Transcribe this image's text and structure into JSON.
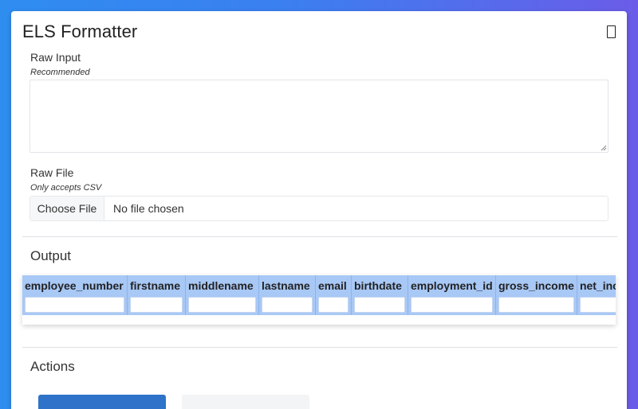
{
  "app": {
    "title": "ELS Formatter"
  },
  "raw_input": {
    "label": "Raw Input",
    "hint": "Recommended",
    "value": ""
  },
  "raw_file": {
    "label": "Raw File",
    "hint": "Only accepts CSV",
    "button_label": "Choose File",
    "status": "No file chosen"
  },
  "output": {
    "title": "Output",
    "columns": [
      "employee_number",
      "firstname",
      "middlename",
      "lastname",
      "email",
      "birthdate",
      "employment_id",
      "gross_income",
      "net_inc"
    ]
  },
  "actions": {
    "title": "Actions"
  },
  "colors": {
    "accent": "#2e73c9",
    "header_bg": "#a8c8f6",
    "bg_gradient_start": "#2f8df0",
    "bg_gradient_end": "#6b5ce8"
  }
}
